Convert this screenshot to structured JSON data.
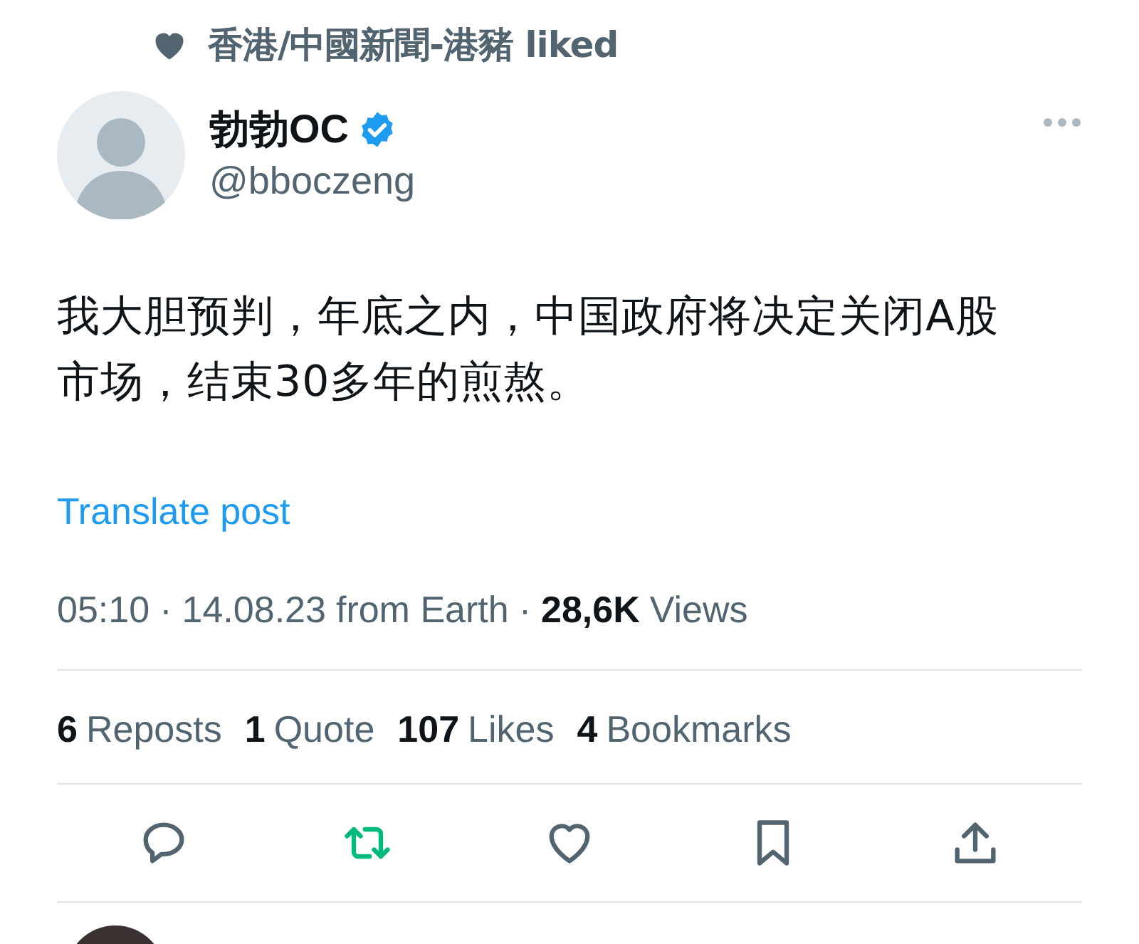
{
  "social_context": {
    "text": "香港/中國新聞-港豬 liked"
  },
  "author": {
    "name": "勃勃OC",
    "verified": true,
    "handle": "@bboczeng"
  },
  "body": "我大胆预判，年底之内，中国政府将决定关闭A股市场，结束30多年的煎熬。",
  "translate": "Translate post",
  "meta": {
    "time": "05:10",
    "separator": "·",
    "date": "14.08.23",
    "source": "from Earth",
    "views_count": "28,6K",
    "views_label": "Views"
  },
  "stats": [
    {
      "count": "6",
      "label": "Reposts"
    },
    {
      "count": "1",
      "label": "Quote"
    },
    {
      "count": "107",
      "label": "Likes"
    },
    {
      "count": "4",
      "label": "Bookmarks"
    }
  ],
  "actions": [
    {
      "kind": "reply",
      "active": false
    },
    {
      "kind": "repost",
      "active": true
    },
    {
      "kind": "like",
      "active": false
    },
    {
      "kind": "bookmark",
      "active": false
    },
    {
      "kind": "share",
      "active": false
    }
  ]
}
